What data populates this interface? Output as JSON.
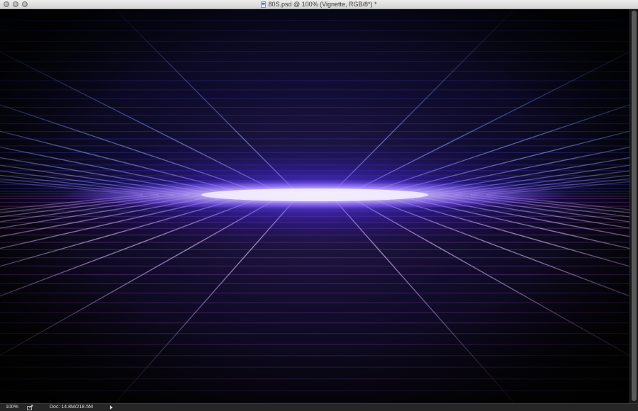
{
  "window": {
    "title": "80S.psd @ 100% (Vignette, RGB/8*) *"
  },
  "status_bar": {
    "zoom": "100%",
    "doc_info": "Doc: 14.8M/218.5M"
  },
  "icons": {
    "close": "close-traffic-light-icon",
    "minimize": "minimize-traffic-light-icon",
    "zoom": "zoom-traffic-light-icon",
    "document": "psd-document-icon",
    "export": "export-icon",
    "status_menu": "play-arrow-icon"
  },
  "colors": {
    "glow_core": "#ece4ff",
    "glow_mid": "#9070ff",
    "upper_grid": "#5a82ff",
    "lower_grid": "#c49be8",
    "background": "#000000"
  }
}
